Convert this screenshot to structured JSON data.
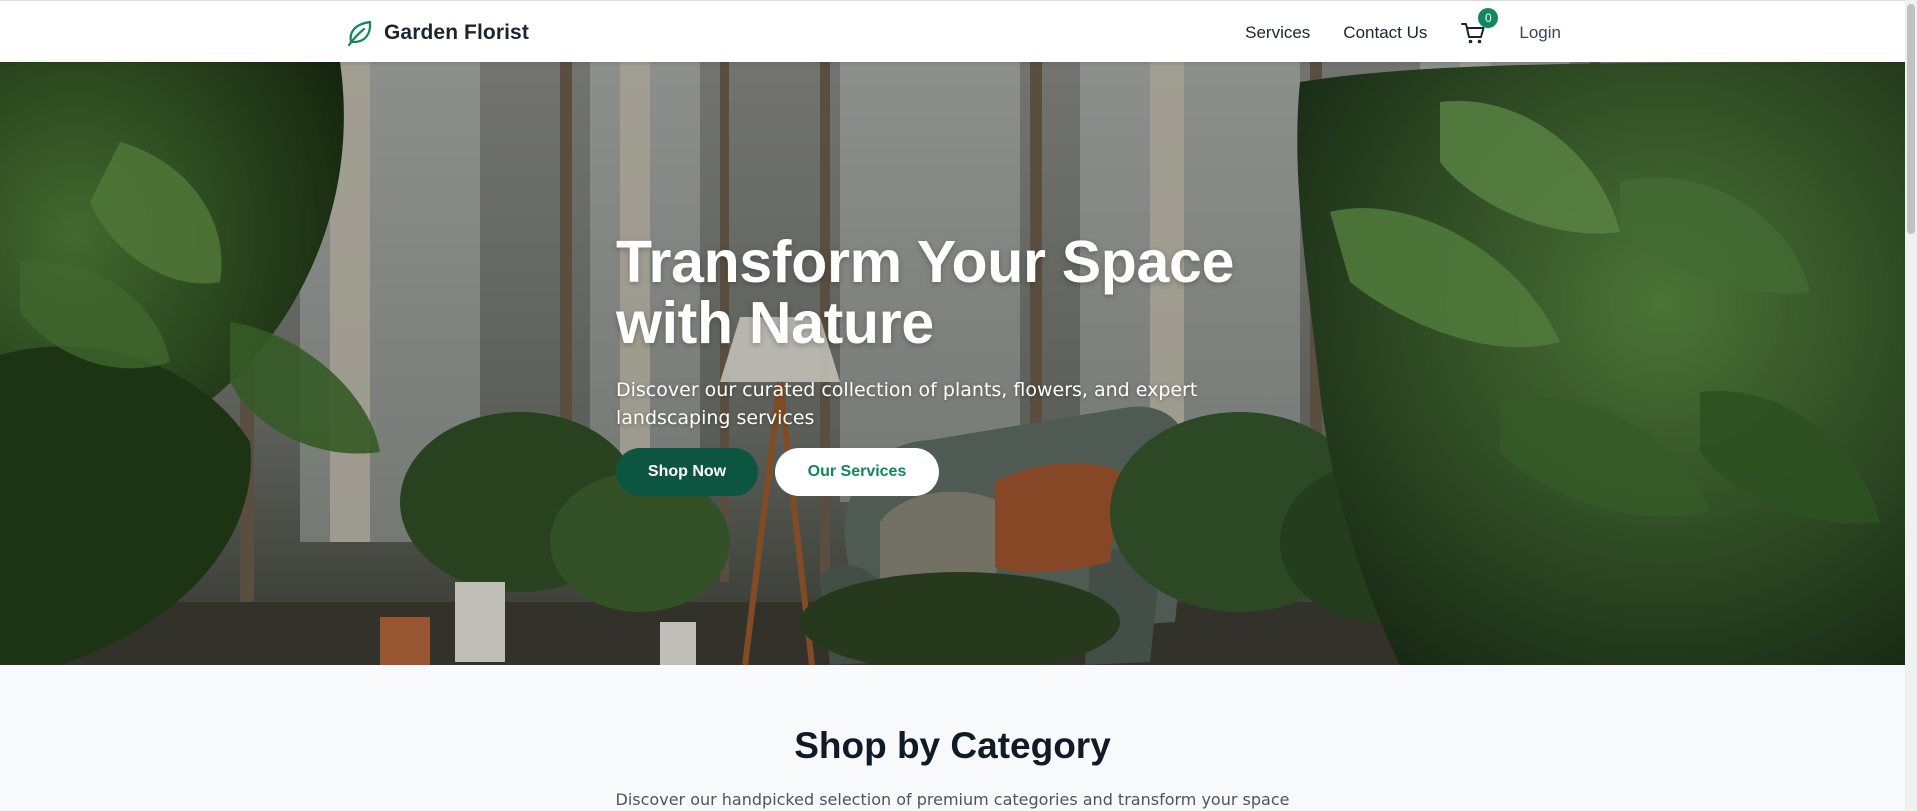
{
  "brand": {
    "name": "Garden Florist",
    "icon": "leaf-icon",
    "accent_color": "#0f8a5f"
  },
  "nav": {
    "services": "Services",
    "contact": "Contact Us",
    "cart_icon": "cart-icon",
    "cart_count": "0",
    "login": "Login"
  },
  "hero": {
    "title_line1": "Transform Your Space",
    "title_line2": "with Nature",
    "subtitle": "Discover our curated collection of plants, flowers, and expert landscaping services",
    "primary_button": "Shop Now",
    "secondary_button": "Our Services",
    "primary_color": "#0c5540"
  },
  "category": {
    "title": "Shop by Category",
    "subtitle": "Discover our handpicked selection of premium categories and transform your space"
  }
}
